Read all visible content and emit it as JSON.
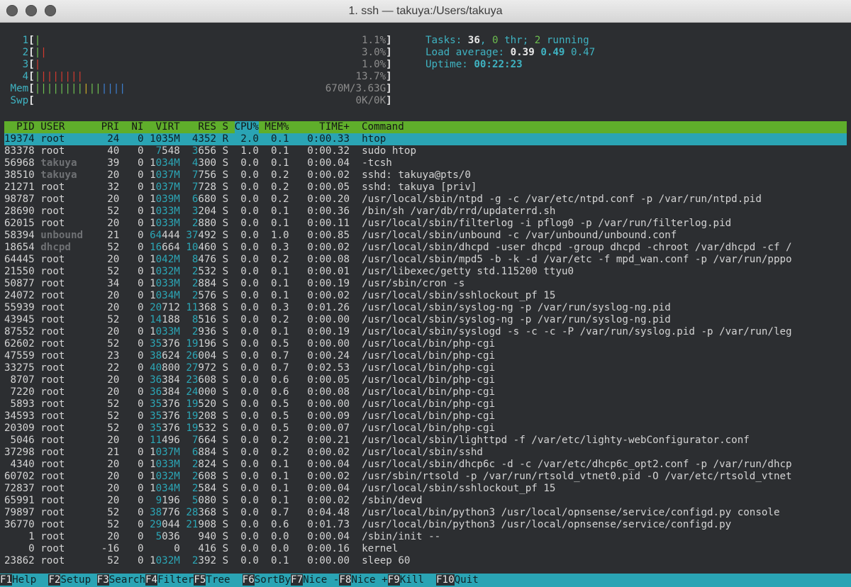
{
  "window": {
    "title": "1. ssh — takuya:/Users/takuya"
  },
  "meters": {
    "cpus": [
      {
        "label": "1",
        "percent": 1.1,
        "text": "1.1%"
      },
      {
        "label": "2",
        "percent": 3.0,
        "text": "3.0%"
      },
      {
        "label": "3",
        "percent": 1.0,
        "text": "1.0%"
      },
      {
        "label": "4",
        "percent": 13.7,
        "text": "13.7%"
      }
    ],
    "mem": {
      "label": "Mem",
      "text": "670M/3.63G",
      "used_fraction": 0.18
    },
    "swp": {
      "label": "Swp",
      "text": "0K/0K",
      "used_fraction": 0.0
    }
  },
  "stats": {
    "tasks_label": "Tasks: ",
    "tasks": "36",
    "thr": "0",
    "thr_label": " thr; ",
    "running": "2",
    "running_label": " running",
    "load_label": "Load average: ",
    "load1": "0.39",
    "load5": "0.49",
    "load15": "0.47",
    "uptime_label": "Uptime: ",
    "uptime": "00:22:23"
  },
  "columns": [
    "PID",
    "USER",
    "PRI",
    "NI",
    "VIRT",
    "RES",
    "S",
    "CPU%",
    "MEM%",
    "TIME+",
    "Command"
  ],
  "processes": [
    {
      "pid": "19374",
      "user": "root",
      "pri": "24",
      "ni": "0",
      "virt": "1035M",
      "res": "4352",
      "s": "R",
      "cpu": "2.0",
      "mem": "0.1",
      "time": "0:00.33",
      "cmd": "htop"
    },
    {
      "pid": "83378",
      "user": "root",
      "pri": "40",
      "ni": "0",
      "virt": "7548",
      "res": "3656",
      "s": "S",
      "cpu": "1.0",
      "mem": "0.1",
      "time": "0:00.32",
      "cmd": "sudo htop"
    },
    {
      "pid": "56968",
      "user": "takuya",
      "pri": "39",
      "ni": "0",
      "virt": "1034M",
      "res": "4300",
      "s": "S",
      "cpu": "0.0",
      "mem": "0.1",
      "time": "0:00.04",
      "cmd": "-tcsh"
    },
    {
      "pid": "38510",
      "user": "takuya",
      "pri": "20",
      "ni": "0",
      "virt": "1037M",
      "res": "7756",
      "s": "S",
      "cpu": "0.0",
      "mem": "0.2",
      "time": "0:00.02",
      "cmd": "sshd: takuya@pts/0"
    },
    {
      "pid": "21271",
      "user": "root",
      "pri": "32",
      "ni": "0",
      "virt": "1037M",
      "res": "7728",
      "s": "S",
      "cpu": "0.0",
      "mem": "0.2",
      "time": "0:00.05",
      "cmd": "sshd: takuya [priv]"
    },
    {
      "pid": "98787",
      "user": "root",
      "pri": "20",
      "ni": "0",
      "virt": "1039M",
      "res": "6680",
      "s": "S",
      "cpu": "0.0",
      "mem": "0.2",
      "time": "0:00.20",
      "cmd": "/usr/local/sbin/ntpd -g -c /var/etc/ntpd.conf -p /var/run/ntpd.pid"
    },
    {
      "pid": "28690",
      "user": "root",
      "pri": "52",
      "ni": "0",
      "virt": "1033M",
      "res": "3204",
      "s": "S",
      "cpu": "0.0",
      "mem": "0.1",
      "time": "0:00.36",
      "cmd": "/bin/sh /var/db/rrd/updaterrd.sh"
    },
    {
      "pid": "62015",
      "user": "root",
      "pri": "20",
      "ni": "0",
      "virt": "1033M",
      "res": "2880",
      "s": "S",
      "cpu": "0.0",
      "mem": "0.1",
      "time": "0:00.11",
      "cmd": "/usr/local/sbin/filterlog -i pflog0 -p /var/run/filterlog.pid"
    },
    {
      "pid": "58394",
      "user": "unbound",
      "pri": "21",
      "ni": "0",
      "virt": "64444",
      "res": "37492",
      "s": "S",
      "cpu": "0.0",
      "mem": "1.0",
      "time": "0:00.85",
      "cmd": "/usr/local/sbin/unbound -c /var/unbound/unbound.conf"
    },
    {
      "pid": "18654",
      "user": "dhcpd",
      "pri": "52",
      "ni": "0",
      "virt": "16664",
      "res": "10460",
      "s": "S",
      "cpu": "0.0",
      "mem": "0.3",
      "time": "0:00.02",
      "cmd": "/usr/local/sbin/dhcpd -user dhcpd -group dhcpd -chroot /var/dhcpd -cf /"
    },
    {
      "pid": "64445",
      "user": "root",
      "pri": "20",
      "ni": "0",
      "virt": "1042M",
      "res": "8476",
      "s": "S",
      "cpu": "0.0",
      "mem": "0.2",
      "time": "0:00.08",
      "cmd": "/usr/local/sbin/mpd5 -b -k -d /var/etc -f mpd_wan.conf -p /var/run/pppo"
    },
    {
      "pid": "21550",
      "user": "root",
      "pri": "52",
      "ni": "0",
      "virt": "1032M",
      "res": "2532",
      "s": "S",
      "cpu": "0.0",
      "mem": "0.1",
      "time": "0:00.01",
      "cmd": "/usr/libexec/getty std.115200 ttyu0"
    },
    {
      "pid": "50877",
      "user": "root",
      "pri": "34",
      "ni": "0",
      "virt": "1033M",
      "res": "2884",
      "s": "S",
      "cpu": "0.0",
      "mem": "0.1",
      "time": "0:00.19",
      "cmd": "/usr/sbin/cron -s"
    },
    {
      "pid": "24072",
      "user": "root",
      "pri": "20",
      "ni": "0",
      "virt": "1034M",
      "res": "2576",
      "s": "S",
      "cpu": "0.0",
      "mem": "0.1",
      "time": "0:00.02",
      "cmd": "/usr/local/sbin/sshlockout_pf 15"
    },
    {
      "pid": "55939",
      "user": "root",
      "pri": "20",
      "ni": "0",
      "virt": "20712",
      "res": "11368",
      "s": "S",
      "cpu": "0.0",
      "mem": "0.3",
      "time": "0:01.26",
      "cmd": "/usr/local/sbin/syslog-ng -p /var/run/syslog-ng.pid"
    },
    {
      "pid": "43945",
      "user": "root",
      "pri": "52",
      "ni": "0",
      "virt": "14188",
      "res": "8516",
      "s": "S",
      "cpu": "0.0",
      "mem": "0.2",
      "time": "0:00.00",
      "cmd": "/usr/local/sbin/syslog-ng -p /var/run/syslog-ng.pid"
    },
    {
      "pid": "87552",
      "user": "root",
      "pri": "20",
      "ni": "0",
      "virt": "1033M",
      "res": "2936",
      "s": "S",
      "cpu": "0.0",
      "mem": "0.1",
      "time": "0:00.19",
      "cmd": "/usr/local/sbin/syslogd -s -c -c -P /var/run/syslog.pid -p /var/run/leg"
    },
    {
      "pid": "62602",
      "user": "root",
      "pri": "52",
      "ni": "0",
      "virt": "35376",
      "res": "19196",
      "s": "S",
      "cpu": "0.0",
      "mem": "0.5",
      "time": "0:00.00",
      "cmd": "/usr/local/bin/php-cgi"
    },
    {
      "pid": "47559",
      "user": "root",
      "pri": "23",
      "ni": "0",
      "virt": "38624",
      "res": "26004",
      "s": "S",
      "cpu": "0.0",
      "mem": "0.7",
      "time": "0:00.24",
      "cmd": "/usr/local/bin/php-cgi"
    },
    {
      "pid": "33275",
      "user": "root",
      "pri": "22",
      "ni": "0",
      "virt": "40800",
      "res": "27972",
      "s": "S",
      "cpu": "0.0",
      "mem": "0.7",
      "time": "0:02.53",
      "cmd": "/usr/local/bin/php-cgi"
    },
    {
      "pid": "8707",
      "user": "root",
      "pri": "20",
      "ni": "0",
      "virt": "36384",
      "res": "23608",
      "s": "S",
      "cpu": "0.0",
      "mem": "0.6",
      "time": "0:00.05",
      "cmd": "/usr/local/bin/php-cgi"
    },
    {
      "pid": "7220",
      "user": "root",
      "pri": "20",
      "ni": "0",
      "virt": "36384",
      "res": "24000",
      "s": "S",
      "cpu": "0.0",
      "mem": "0.6",
      "time": "0:00.08",
      "cmd": "/usr/local/bin/php-cgi"
    },
    {
      "pid": "5893",
      "user": "root",
      "pri": "52",
      "ni": "0",
      "virt": "35376",
      "res": "19520",
      "s": "S",
      "cpu": "0.0",
      "mem": "0.5",
      "time": "0:00.00",
      "cmd": "/usr/local/bin/php-cgi"
    },
    {
      "pid": "34593",
      "user": "root",
      "pri": "52",
      "ni": "0",
      "virt": "35376",
      "res": "19208",
      "s": "S",
      "cpu": "0.0",
      "mem": "0.5",
      "time": "0:00.09",
      "cmd": "/usr/local/bin/php-cgi"
    },
    {
      "pid": "20309",
      "user": "root",
      "pri": "52",
      "ni": "0",
      "virt": "35376",
      "res": "19532",
      "s": "S",
      "cpu": "0.0",
      "mem": "0.5",
      "time": "0:00.07",
      "cmd": "/usr/local/bin/php-cgi"
    },
    {
      "pid": "5046",
      "user": "root",
      "pri": "20",
      "ni": "0",
      "virt": "11496",
      "res": "7664",
      "s": "S",
      "cpu": "0.0",
      "mem": "0.2",
      "time": "0:00.21",
      "cmd": "/usr/local/sbin/lighttpd -f /var/etc/lighty-webConfigurator.conf"
    },
    {
      "pid": "37298",
      "user": "root",
      "pri": "21",
      "ni": "0",
      "virt": "1037M",
      "res": "6884",
      "s": "S",
      "cpu": "0.0",
      "mem": "0.2",
      "time": "0:00.02",
      "cmd": "/usr/local/sbin/sshd"
    },
    {
      "pid": "4340",
      "user": "root",
      "pri": "20",
      "ni": "0",
      "virt": "1033M",
      "res": "2824",
      "s": "S",
      "cpu": "0.0",
      "mem": "0.1",
      "time": "0:00.04",
      "cmd": "/usr/local/sbin/dhcp6c -d -c /var/etc/dhcp6c_opt2.conf -p /var/run/dhcp"
    },
    {
      "pid": "60702",
      "user": "root",
      "pri": "20",
      "ni": "0",
      "virt": "1032M",
      "res": "2608",
      "s": "S",
      "cpu": "0.0",
      "mem": "0.1",
      "time": "0:00.02",
      "cmd": "/usr/sbin/rtsold -p /var/run/rtsold_vtnet0.pid -O /var/etc/rtsold_vtnet"
    },
    {
      "pid": "72837",
      "user": "root",
      "pri": "20",
      "ni": "0",
      "virt": "1034M",
      "res": "2584",
      "s": "S",
      "cpu": "0.0",
      "mem": "0.1",
      "time": "0:00.04",
      "cmd": "/usr/local/sbin/sshlockout_pf 15"
    },
    {
      "pid": "65991",
      "user": "root",
      "pri": "20",
      "ni": "0",
      "virt": "9196",
      "res": "5080",
      "s": "S",
      "cpu": "0.0",
      "mem": "0.1",
      "time": "0:00.02",
      "cmd": "/sbin/devd"
    },
    {
      "pid": "79897",
      "user": "root",
      "pri": "52",
      "ni": "0",
      "virt": "38776",
      "res": "28368",
      "s": "S",
      "cpu": "0.0",
      "mem": "0.7",
      "time": "0:04.48",
      "cmd": "/usr/local/bin/python3 /usr/local/opnsense/service/configd.py console"
    },
    {
      "pid": "36770",
      "user": "root",
      "pri": "52",
      "ni": "0",
      "virt": "29044",
      "res": "21908",
      "s": "S",
      "cpu": "0.0",
      "mem": "0.6",
      "time": "0:01.73",
      "cmd": "/usr/local/bin/python3 /usr/local/opnsense/service/configd.py"
    },
    {
      "pid": "1",
      "user": "root",
      "pri": "20",
      "ni": "0",
      "virt": "5036",
      "res": "940",
      "s": "S",
      "cpu": "0.0",
      "mem": "0.0",
      "time": "0:00.04",
      "cmd": "/sbin/init --"
    },
    {
      "pid": "0",
      "user": "root",
      "pri": "-16",
      "ni": "0",
      "virt": "0",
      "res": "416",
      "s": "S",
      "cpu": "0.0",
      "mem": "0.0",
      "time": "0:00.16",
      "cmd": "kernel"
    },
    {
      "pid": "23862",
      "user": "root",
      "pri": "52",
      "ni": "0",
      "virt": "1032M",
      "res": "2392",
      "s": "S",
      "cpu": "0.0",
      "mem": "0.1",
      "time": "0:00.00",
      "cmd": "sleep 60"
    }
  ],
  "function_keys": [
    {
      "key": "F1",
      "label": "Help"
    },
    {
      "key": "F2",
      "label": "Setup"
    },
    {
      "key": "F3",
      "label": "Search"
    },
    {
      "key": "F4",
      "label": "Filter"
    },
    {
      "key": "F5",
      "label": "Tree"
    },
    {
      "key": "F6",
      "label": "SortBy"
    },
    {
      "key": "F7",
      "label": "Nice -"
    },
    {
      "key": "F8",
      "label": "Nice +"
    },
    {
      "key": "F9",
      "label": "Kill"
    },
    {
      "key": "F10",
      "label": "Quit"
    }
  ],
  "colors": {
    "header_bg": "#5fae2b",
    "selection_bg": "#2aa4b4",
    "terminal_bg": "#2c2e31"
  }
}
